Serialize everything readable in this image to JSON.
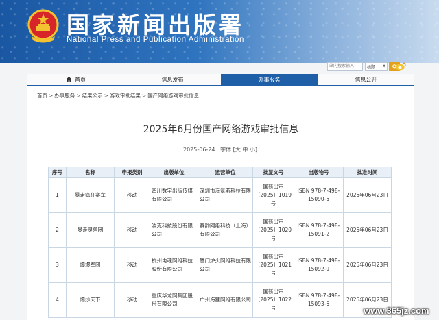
{
  "header": {
    "title": "国家新闻出版署",
    "subtitle": "National  Press  and  Publication  Administration",
    "emblem_icon": "national-emblem-icon"
  },
  "search": {
    "placeholder": "站内搜索输入",
    "select_value": "标题",
    "button_icon": "search-icon",
    "social_icon": "weibo-icon"
  },
  "nav": {
    "items": [
      {
        "label": "首页",
        "icon": "home-icon"
      },
      {
        "label": "信息发布"
      },
      {
        "label": "办事服务"
      },
      {
        "label": "信息公开"
      }
    ],
    "active_index": 2
  },
  "breadcrumb": [
    "首页",
    "办事服务",
    "结果公示",
    "游戏审批结果",
    "国产网络游戏审批信息"
  ],
  "breadcrumb_sep": ">",
  "article": {
    "title": "2025年6月份国产网络游戏审批信息",
    "date": "2025-06-24",
    "font_label": "字体",
    "font_sizes": [
      "大",
      "中",
      "小"
    ]
  },
  "table": {
    "headers": [
      "序号",
      "名称",
      "申报类别",
      "出版单位",
      "运营单位",
      "批复文号",
      "出版物号",
      "批准时间"
    ],
    "rows": [
      [
        "1",
        "暴走疯狂赛车",
        "移动",
        "四川数字出版传媒有限公司",
        "深圳市海氪斯科技有限公司",
        "国新出审〔2025〕1019号",
        "ISBN 978-7-498-15090-5",
        "2025年06月23日"
      ],
      [
        "2",
        "暴走灵兽团",
        "移动",
        "波克科技股份有限公司",
        "赛韵网络科技（上海）有限公司",
        "国新出审〔2025〕1020号",
        "ISBN 978-7-498-15091-2",
        "2025年06月23日"
      ],
      [
        "3",
        "爆爆军团",
        "移动",
        "杭州电魂网络科技股份有限公司",
        "厦门炉火网络科技有限公司",
        "国新出审〔2025〕1021号",
        "ISBN 978-7-498-15092-9",
        "2025年06月23日"
      ],
      [
        "4",
        "爆炒天下",
        "移动",
        "重庆华龙网集团股份有限公司",
        "广州海狸网络有限公司",
        "国新出审〔2025〕1022号",
        "ISBN 978-7-498-15093-6",
        "2025年06月23日"
      ]
    ]
  },
  "watermark": "www.365jz.com",
  "colors": {
    "nav_active": "#1e5fa8",
    "banner": "#2f74bf",
    "header_cell": "#e9eff6",
    "search_button": "#e1a11a"
  }
}
